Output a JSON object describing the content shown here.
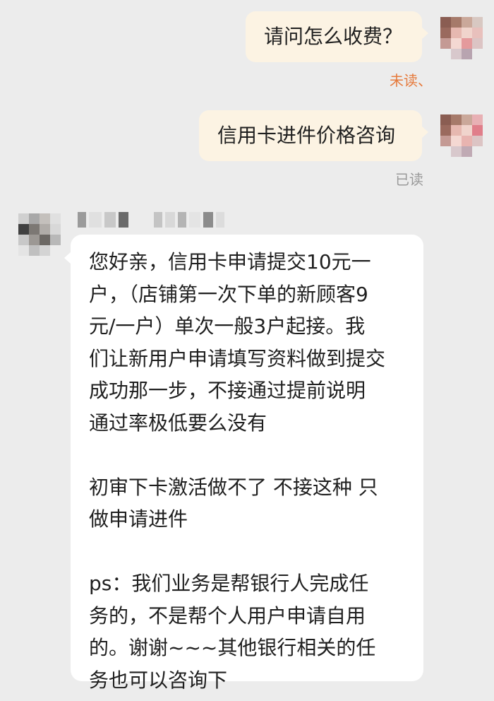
{
  "messages_out": [
    {
      "text": "请问怎么收费？",
      "status": "未读、"
    },
    {
      "text": "信用卡进件价格咨询",
      "status": "已读"
    }
  ],
  "message_in": {
    "lines": [
      "您好亲，信用卡申请提交10元一",
      "户，（店铺第一次下单的新顾客9",
      "元/一户）单次一般3户起接。我",
      "们让新用户申请填写资料做到提交",
      "成功那一步，不接通过提前说明",
      "通过率极低要么没有",
      "",
      "初审下卡激活做不了 不接这种 只",
      "做申请进件",
      "",
      "ps：我们业务是帮银行人完成任",
      "务的，不是帮个人用户申请自用",
      "的。谢谢~~~其他银行相关的任",
      "务也可以咨询下"
    ]
  },
  "colors": {
    "background": "#ececec",
    "outgoing_bubble": "#fcf3e3",
    "incoming_bubble": "#ffffff",
    "unread_status": "#e67a3c",
    "read_status": "#9a9a9a"
  }
}
